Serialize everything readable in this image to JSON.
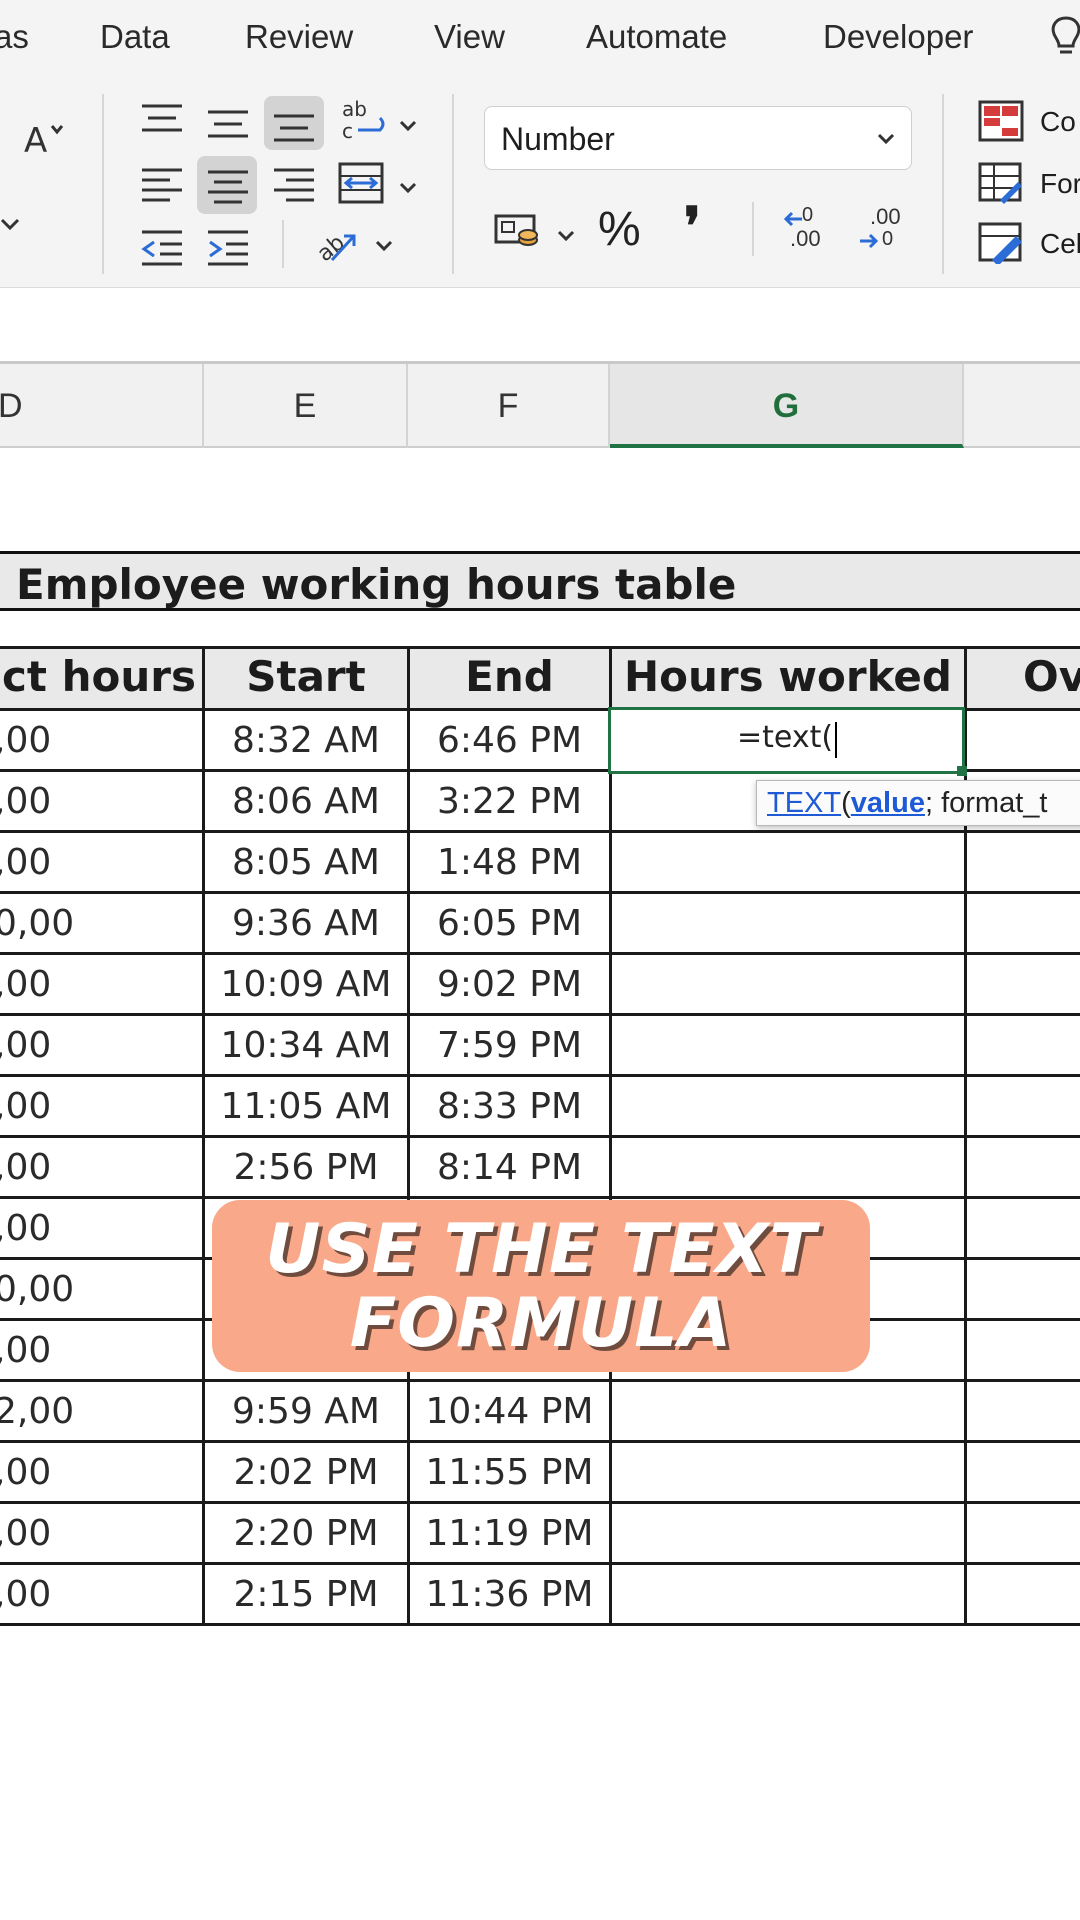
{
  "ribbon": {
    "tabs": [
      "as",
      "Data",
      "Review",
      "View",
      "Automate",
      "Developer"
    ],
    "number_format": "Number",
    "percent_symbol": "%",
    "comma_symbol": "❜",
    "increase_decimal_text": ".00",
    "decrease_decimal_text": ".00",
    "styles": [
      "Co",
      "For",
      "Cel"
    ]
  },
  "columns": {
    "headers": [
      "D",
      "E",
      "F",
      "G"
    ],
    "selected": "G"
  },
  "sheet": {
    "title": "Employee working hours table",
    "headers": [
      "ct hours",
      "Start",
      "End",
      "Hours worked",
      "Ov"
    ],
    "rows": [
      {
        "d": ",00",
        "start": "8:32 AM",
        "end": "6:46 PM"
      },
      {
        "d": ",00",
        "start": "8:06 AM",
        "end": "3:22 PM"
      },
      {
        "d": ",00",
        "start": "8:05 AM",
        "end": "1:48 PM"
      },
      {
        "d": "0,00",
        "start": "9:36 AM",
        "end": "6:05 PM"
      },
      {
        "d": ",00",
        "start": "10:09 AM",
        "end": "9:02 PM"
      },
      {
        "d": ",00",
        "start": "10:34 AM",
        "end": "7:59 PM"
      },
      {
        "d": ",00",
        "start": "11:05 AM",
        "end": "8:33 PM"
      },
      {
        "d": ",00",
        "start": "2:56 PM",
        "end": "8:14 PM"
      },
      {
        "d": ",00",
        "start": "",
        "end": ""
      },
      {
        "d": "0,00",
        "start": "",
        "end": ""
      },
      {
        "d": ",00",
        "start": "",
        "end": ""
      },
      {
        "d": "2,00",
        "start": "9:59 AM",
        "end": "10:44 PM"
      },
      {
        "d": ",00",
        "start": "2:02 PM",
        "end": "11:55 PM"
      },
      {
        "d": ",00",
        "start": "2:20 PM",
        "end": "11:19 PM"
      },
      {
        "d": ",00",
        "start": "2:15 PM",
        "end": "11:36 PM"
      }
    ],
    "active_cell_input": "=text(",
    "tooltip": {
      "function": "TEXT",
      "open_paren": "(",
      "arg": "value",
      "rest": "; format_t"
    }
  },
  "overlay": {
    "line1": "USE THE TEXT",
    "line2": "FORMULA"
  },
  "colors": {
    "accent_green": "#217346",
    "caption_bg": "#f9a98a",
    "tooltip_link": "#1e5ad6"
  }
}
